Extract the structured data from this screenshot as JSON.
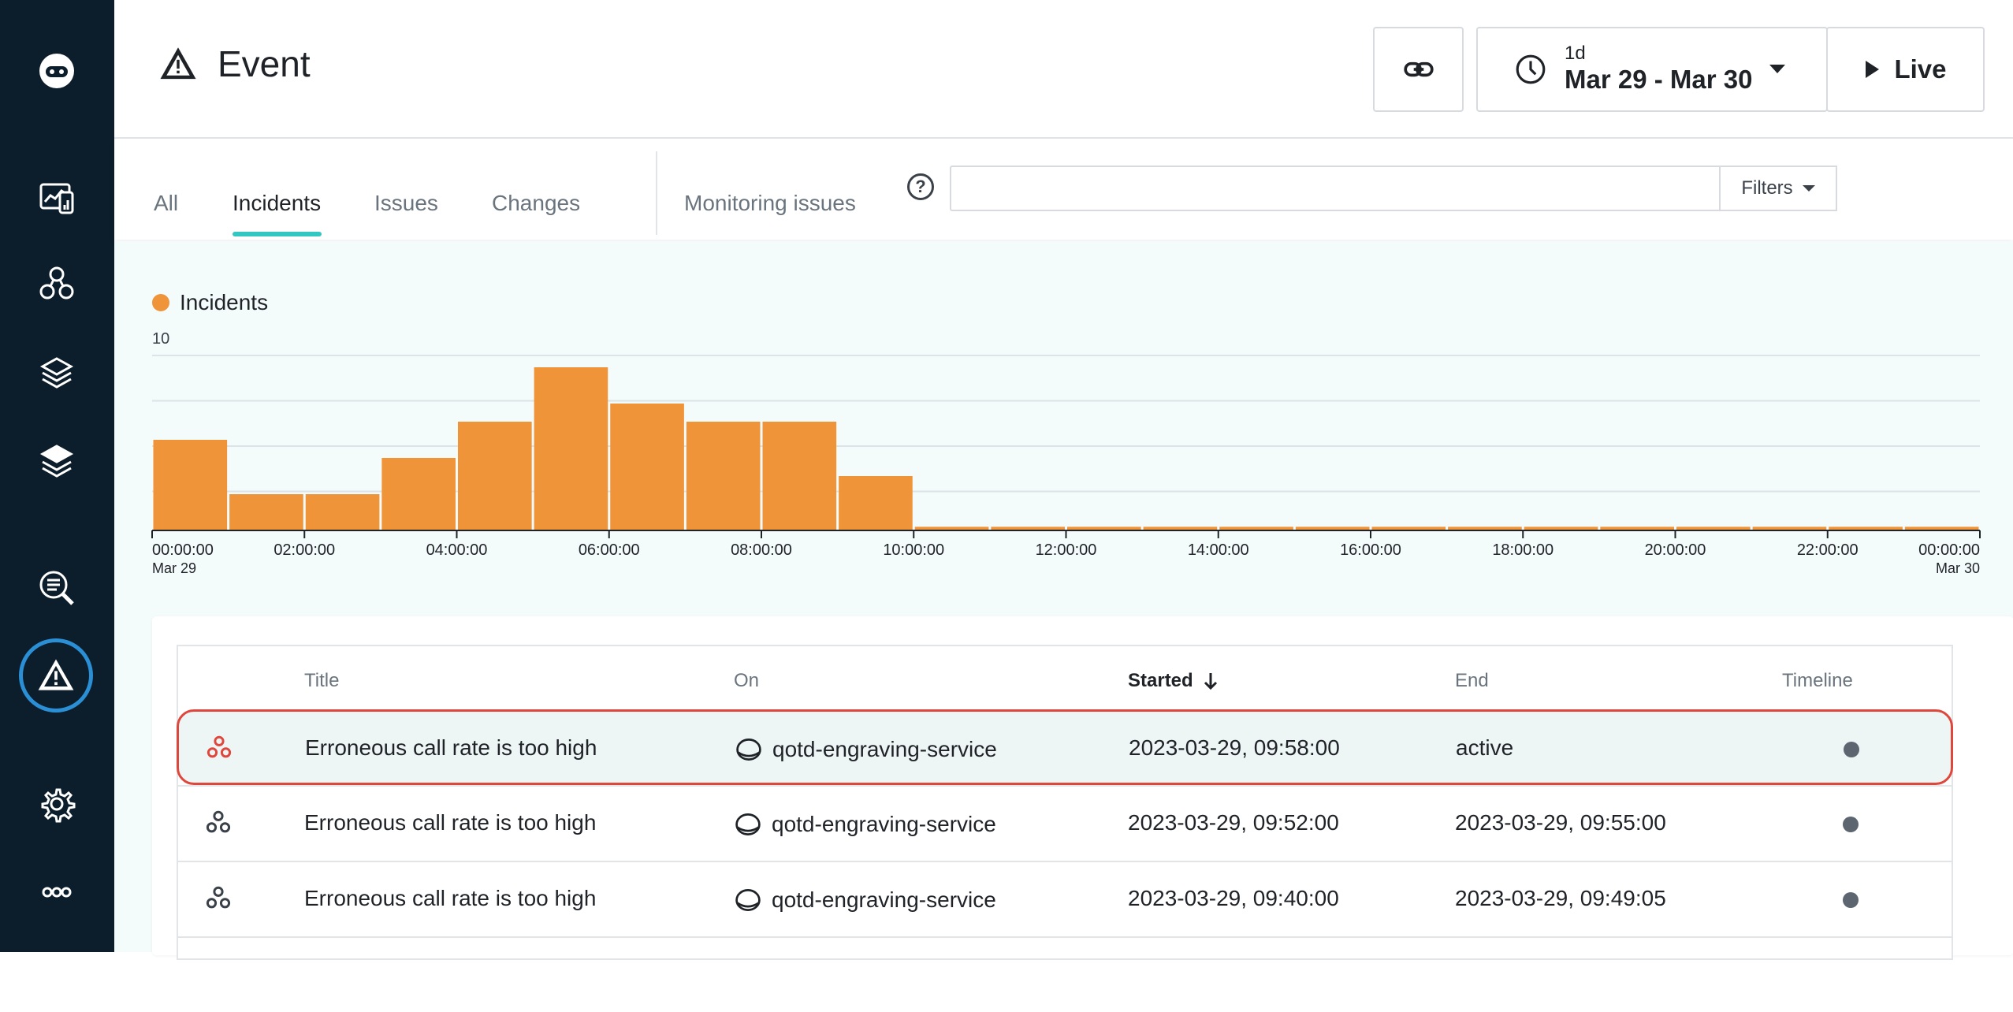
{
  "page": {
    "title": "Event"
  },
  "sidebar": {
    "items": [
      {
        "icon": "robot-logo-icon"
      },
      {
        "icon": "dashboard-icon"
      },
      {
        "icon": "application-perspective-icon"
      },
      {
        "icon": "service-icon"
      },
      {
        "icon": "infrastructure-stack-icon"
      },
      {
        "icon": "analytics-icon"
      },
      {
        "icon": "events-warning-icon",
        "active": true
      },
      {
        "icon": "settings-gear-icon"
      },
      {
        "icon": "more-icon"
      }
    ]
  },
  "header": {
    "time_range": {
      "duration": "1d",
      "range": "Mar 29 - Mar 30"
    },
    "live_label": "Live"
  },
  "tabs": {
    "items": [
      "All",
      "Incidents",
      "Issues",
      "Changes"
    ],
    "active": "Incidents",
    "monitoring": "Monitoring issues"
  },
  "search": {
    "value": "",
    "filters_label": "Filters"
  },
  "chart_data": {
    "type": "bar",
    "legend": "Incidents",
    "color": "#f0943a",
    "ylim": [
      0,
      10
    ],
    "y_ticks": [
      "10"
    ],
    "x_ticks": [
      "00:00:00",
      "02:00:00",
      "04:00:00",
      "06:00:00",
      "08:00:00",
      "10:00:00",
      "12:00:00",
      "14:00:00",
      "16:00:00",
      "18:00:00",
      "20:00:00",
      "22:00:00",
      "00:00:00"
    ],
    "x_sub": {
      "start": "Mar 29",
      "end": "Mar 30"
    },
    "values": [
      5,
      2,
      2,
      4,
      6,
      9,
      7,
      6,
      6,
      3,
      0.2,
      0.2,
      0.2,
      0.2,
      0.2,
      0.2,
      0.2,
      0.2,
      0.2,
      0.2,
      0.2,
      0.2,
      0.2,
      0.2
    ]
  },
  "table": {
    "headers": {
      "title": "Title",
      "on": "On",
      "started": "Started",
      "end": "End",
      "timeline": "Timeline"
    },
    "rows": [
      {
        "title": "Erroneous call rate is too high",
        "on": "qotd-engraving-service",
        "started": "2023-03-29, 09:58:00",
        "end": "active",
        "selected": true
      },
      {
        "title": "Erroneous call rate is too high",
        "on": "qotd-engraving-service",
        "started": "2023-03-29, 09:52:00",
        "end": "2023-03-29, 09:55:00"
      },
      {
        "title": "Erroneous call rate is too high",
        "on": "qotd-engraving-service",
        "started": "2023-03-29, 09:40:00",
        "end": "2023-03-29, 09:49:05"
      }
    ]
  }
}
